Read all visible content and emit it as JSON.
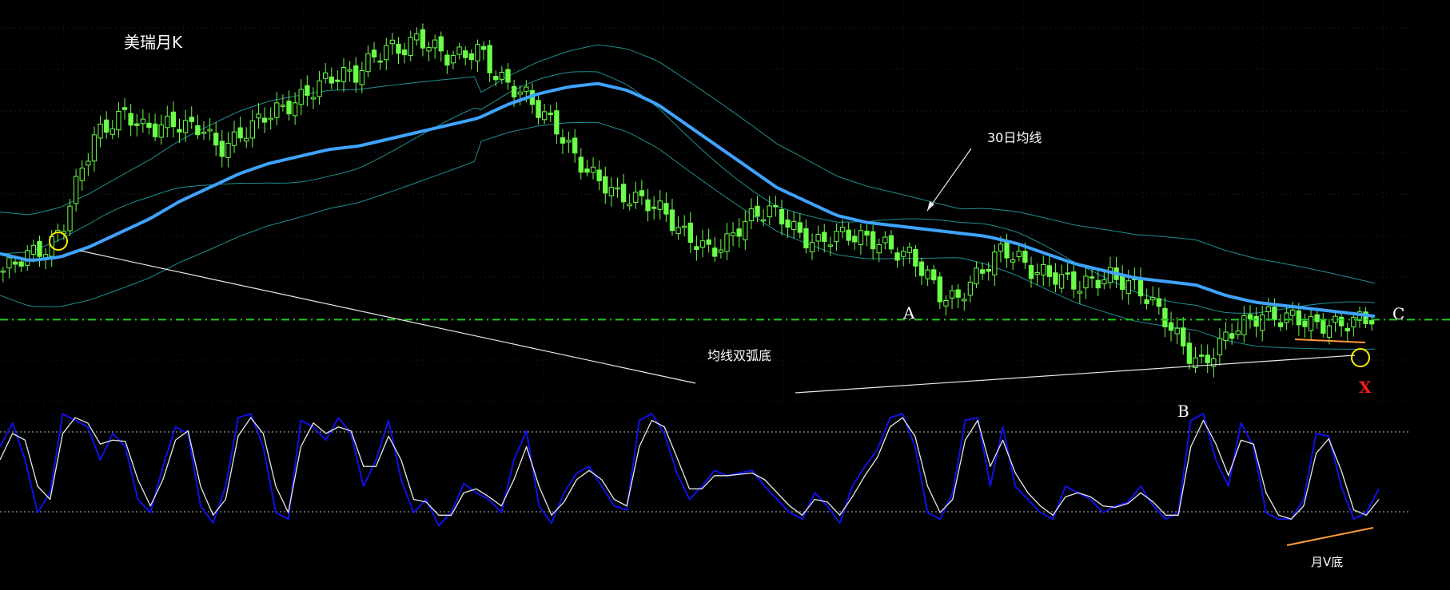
{
  "title": "美瑞月K",
  "annotations": {
    "ma_label": "30日均线",
    "pattern_label": "均线双弧底",
    "point_a": "A",
    "point_b": "B",
    "point_c": "C",
    "point_x": "X",
    "osc_label": "月V底"
  },
  "colors": {
    "background": "#000000",
    "candle": "#6cff4a",
    "ma": "#3fa3ff",
    "bollinger": "#1f8f92",
    "support": "#22cc22",
    "osc_k": "#1010e8",
    "osc_d": "#e8e8e8",
    "trendline": "#e8e8e8",
    "marker_circle": "#ffee00",
    "orange": "#ff9a3c",
    "x_marker": "#ff1a1a"
  },
  "chart_data": [
    {
      "type": "candlestick",
      "title": "美瑞月K",
      "indicators": [
        "MA30",
        "Bollinger Bands"
      ],
      "grid": true,
      "series": [
        {
          "name": "price_close_path",
          "values": [
            0.3,
            0.32,
            0.34,
            0.36,
            0.45,
            0.6,
            0.7,
            0.72,
            0.74,
            0.7,
            0.71,
            0.74,
            0.73,
            0.72,
            0.64,
            0.66,
            0.7,
            0.75,
            0.78,
            0.8,
            0.82,
            0.84,
            0.85,
            0.86,
            0.92,
            0.96,
            0.95,
            0.97,
            0.93,
            0.9,
            0.92,
            0.95,
            0.88,
            0.84,
            0.8,
            0.74,
            0.7,
            0.64,
            0.6,
            0.57,
            0.52,
            0.5,
            0.48,
            0.46,
            0.42,
            0.4,
            0.37,
            0.38,
            0.42,
            0.45,
            0.47,
            0.45,
            0.41,
            0.39,
            0.4,
            0.39,
            0.38,
            0.38,
            0.37,
            0.36,
            0.3,
            0.22,
            0.2,
            0.26,
            0.32,
            0.38,
            0.35,
            0.3,
            0.28,
            0.26,
            0.25,
            0.28,
            0.3,
            0.28,
            0.24,
            0.18,
            0.12,
            0.06,
            0.04,
            0.1,
            0.14,
            0.15,
            0.16,
            0.15,
            0.17,
            0.16,
            0.16,
            0.15,
            0.15,
            0.15
          ]
        },
        {
          "name": "MA30",
          "values": [
            0.35,
            0.33,
            0.34,
            0.37,
            0.41,
            0.45,
            0.5,
            0.54,
            0.58,
            0.61,
            0.63,
            0.65,
            0.66,
            0.68,
            0.7,
            0.72,
            0.74,
            0.78,
            0.81,
            0.83,
            0.84,
            0.82,
            0.78,
            0.72,
            0.66,
            0.6,
            0.54,
            0.5,
            0.46,
            0.44,
            0.43,
            0.42,
            0.41,
            0.4,
            0.38,
            0.35,
            0.32,
            0.3,
            0.28,
            0.27,
            0.26,
            0.23,
            0.21,
            0.2,
            0.19,
            0.18,
            0.17
          ]
        }
      ],
      "support_line": 0.16
    },
    {
      "type": "line",
      "indicator": "Stochastic oscillator",
      "levels": [
        80,
        20
      ],
      "series": [
        {
          "name": "K",
          "values": [
            70,
            88,
            60,
            20,
            35,
            95,
            90,
            85,
            60,
            80,
            70,
            30,
            20,
            55,
            85,
            80,
            25,
            12,
            40,
            92,
            95,
            70,
            20,
            15,
            90,
            85,
            75,
            92,
            80,
            40,
            60,
            90,
            45,
            20,
            30,
            10,
            20,
            42,
            35,
            30,
            20,
            60,
            82,
            25,
            12,
            35,
            50,
            55,
            40,
            25,
            22,
            90,
            95,
            80,
            50,
            30,
            40,
            52,
            48,
            50,
            52,
            40,
            30,
            20,
            15,
            35,
            25,
            12,
            40,
            55,
            68,
            92,
            95,
            70,
            20,
            15,
            35,
            90,
            92,
            40,
            85,
            40,
            30,
            20,
            15,
            40,
            35,
            30,
            20,
            25,
            28,
            40,
            25,
            15,
            20,
            90,
            95,
            60,
            40,
            88,
            70,
            20,
            15,
            15,
            30,
            80,
            78,
            40,
            15,
            20,
            38
          ]
        },
        {
          "name": "D",
          "values": [
            60,
            80,
            75,
            40,
            30,
            80,
            92,
            88,
            72,
            75,
            74,
            45,
            25,
            45,
            75,
            82,
            40,
            18,
            30,
            78,
            92,
            80,
            40,
            20,
            70,
            88,
            80,
            85,
            82,
            55,
            55,
            78,
            60,
            30,
            28,
            18,
            18,
            35,
            38,
            32,
            25,
            45,
            70,
            40,
            18,
            28,
            45,
            52,
            45,
            30,
            25,
            70,
            90,
            85,
            62,
            38,
            38,
            48,
            48,
            49,
            50,
            45,
            35,
            25,
            18,
            30,
            28,
            18,
            32,
            48,
            62,
            85,
            92,
            78,
            40,
            20,
            30,
            75,
            90,
            55,
            75,
            50,
            35,
            25,
            18,
            32,
            35,
            32,
            25,
            24,
            27,
            35,
            28,
            18,
            18,
            70,
            90,
            72,
            48,
            75,
            72,
            35,
            18,
            15,
            25,
            65,
            76,
            52,
            22,
            18,
            30
          ]
        }
      ]
    }
  ]
}
